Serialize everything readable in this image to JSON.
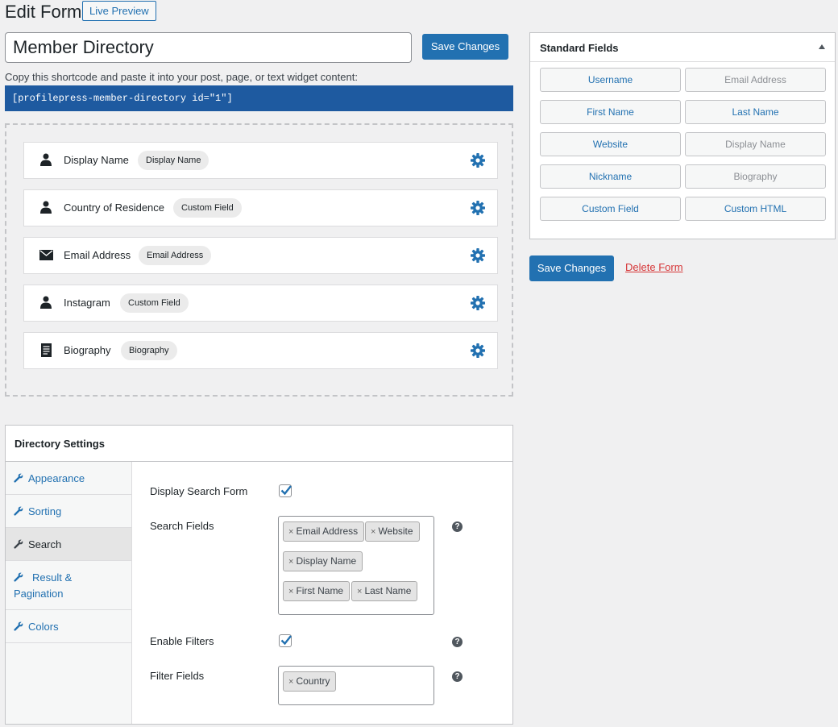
{
  "header": {
    "title": "Edit Form",
    "live_preview_label": "Live Preview"
  },
  "form": {
    "title_value": "Member Directory",
    "save_label": "Save Changes",
    "shortcode_hint": "Copy this shortcode and paste it into your post, page, or text widget content:",
    "shortcode": "[profilepress-member-directory id=\"1\"]"
  },
  "fields": [
    {
      "icon": "user-icon",
      "label": "Display Name",
      "badge": "Display Name"
    },
    {
      "icon": "user-icon",
      "label": "Country of Residence",
      "badge": "Custom Field"
    },
    {
      "icon": "envelope-icon",
      "label": "Email Address",
      "badge": "Email Address"
    },
    {
      "icon": "user-icon",
      "label": "Instagram",
      "badge": "Custom Field"
    },
    {
      "icon": "document-icon",
      "label": "Biography",
      "badge": "Biography"
    }
  ],
  "standard_fields": {
    "title": "Standard Fields",
    "buttons": [
      {
        "label": "Username",
        "state": "active"
      },
      {
        "label": "Email Address",
        "state": "disabled"
      },
      {
        "label": "First Name",
        "state": "active"
      },
      {
        "label": "Last Name",
        "state": "active"
      },
      {
        "label": "Website",
        "state": "active"
      },
      {
        "label": "Display Name",
        "state": "disabled"
      },
      {
        "label": "Nickname",
        "state": "active"
      },
      {
        "label": "Biography",
        "state": "disabled"
      },
      {
        "label": "Custom Field",
        "state": "active"
      },
      {
        "label": "Custom HTML",
        "state": "active"
      }
    ]
  },
  "sidebar_actions": {
    "save_label": "Save Changes",
    "delete_label": "Delete Form"
  },
  "directory_settings": {
    "title": "Directory Settings",
    "tabs": [
      {
        "label": "Appearance",
        "active": false
      },
      {
        "label": "Sorting",
        "active": false
      },
      {
        "label": "Search",
        "active": true
      },
      {
        "label": "Result & Pagination",
        "active": false
      },
      {
        "label": "Colors",
        "active": false
      }
    ],
    "search": {
      "display_search_form_label": "Display Search Form",
      "display_search_form_checked": true,
      "search_fields_label": "Search Fields",
      "search_fields": [
        "Email Address",
        "Website",
        "Display Name",
        "First Name",
        "Last Name"
      ],
      "enable_filters_label": "Enable Filters",
      "enable_filters_checked": true,
      "filter_fields_label": "Filter Fields",
      "filter_fields": [
        "Country"
      ],
      "remove_symbol": "×",
      "help_symbol": "?"
    }
  },
  "colors": {
    "primary": "#2271b1",
    "shortcode_bg": "#1e5aa0",
    "danger": "#d63638"
  }
}
